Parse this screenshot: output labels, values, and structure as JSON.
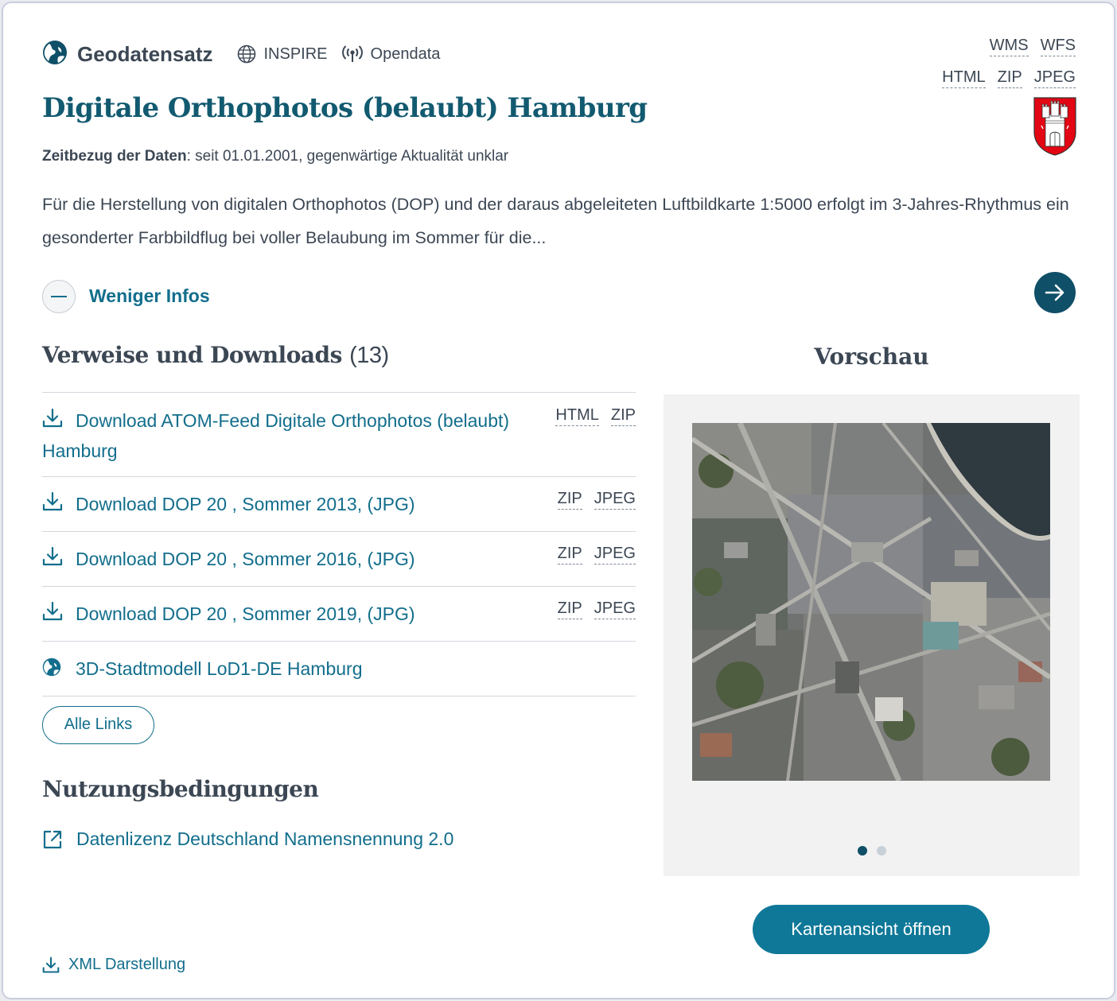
{
  "header": {
    "type_label": "Geodatensatz",
    "type_icon": "globe-icon",
    "badges": [
      {
        "label": "INSPIRE",
        "icon": "inspire-globe-icon"
      },
      {
        "label": "Opendata",
        "icon": "broadcast-icon"
      }
    ],
    "formats_line1": [
      "WMS",
      "WFS"
    ],
    "formats_line2": [
      "HTML",
      "ZIP",
      "JPEG"
    ],
    "crest_icon": "hamburg-coat-of-arms-icon"
  },
  "dataset": {
    "title": "Digitale Orthophotos (belaubt) Hamburg",
    "time_ref_label": "Zeitbezug der Daten",
    "time_ref_value": ": seit 01.01.2001, gegenwärtige Aktualität unklar",
    "description": "Für die Herstellung von digitalen Orthophotos (DOP) und der daraus abgeleiteten Luftbildkarte 1:5000 erfolgt im 3-Jahres-Rhythmus ein gesonderter Farbbildflug bei voller Belaubung im Sommer für die...",
    "less_info_label": "Weniger Infos"
  },
  "links_section": {
    "title": "Verweise und Downloads",
    "count": "(13)",
    "items": [
      {
        "label": "Download ATOM-Feed Digitale Orthophotos (belaubt) Hamburg",
        "icon": "download-icon",
        "formats": [
          "HTML",
          "ZIP"
        ]
      },
      {
        "label": "Download DOP 20 , Sommer 2013, (JPG)",
        "icon": "download-icon",
        "formats": [
          "ZIP",
          "JPEG"
        ]
      },
      {
        "label": "Download DOP 20 , Sommer 2016, (JPG)",
        "icon": "download-icon",
        "formats": [
          "ZIP",
          "JPEG"
        ]
      },
      {
        "label": "Download DOP 20 , Sommer 2019, (JPG)",
        "icon": "download-icon",
        "formats": [
          "ZIP",
          "JPEG"
        ]
      },
      {
        "label": "3D-Stadtmodell LoD1-DE Hamburg",
        "icon": "globe-icon",
        "formats": []
      }
    ],
    "all_links_label": "Alle Links"
  },
  "terms_section": {
    "title": "Nutzungsbedingungen",
    "license_label": "Datenlizenz Deutschland Namensnennung 2.0",
    "license_icon": "external-link-icon"
  },
  "xml_label": "XML Darstellung",
  "preview": {
    "title": "Vorschau",
    "slides_total": 2,
    "active_slide": 1,
    "map_button_label": "Kartenansicht öffnen"
  },
  "colors": {
    "accent": "#126e8c",
    "title": "#125a70",
    "dark_button": "#0f4f68",
    "primary_button": "#0f7898",
    "text": "#3c4754"
  }
}
